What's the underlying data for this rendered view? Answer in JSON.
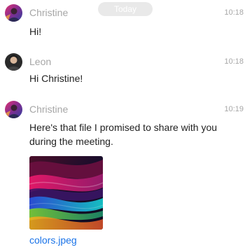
{
  "date_separator": "Today",
  "messages": [
    {
      "sender": "Christine",
      "time": "10:18",
      "text": "Hi!",
      "avatar_icon": "christine-avatar"
    },
    {
      "sender": "Leon",
      "time": "10:18",
      "text": "Hi Christine!",
      "avatar_icon": "leon-avatar"
    },
    {
      "sender": "Christine",
      "time": "10:19",
      "text": "Here's that file I promised to share with you during the meeting.",
      "avatar_icon": "christine-avatar",
      "attachment": {
        "file_name": "colors.jpeg",
        "icon": "image-thumbnail"
      }
    }
  ],
  "colors": {
    "meta_text": "#a6a6a6",
    "body_text": "#222222",
    "link": "#1a73e8",
    "date_pill_bg": "#e9e9e9"
  }
}
